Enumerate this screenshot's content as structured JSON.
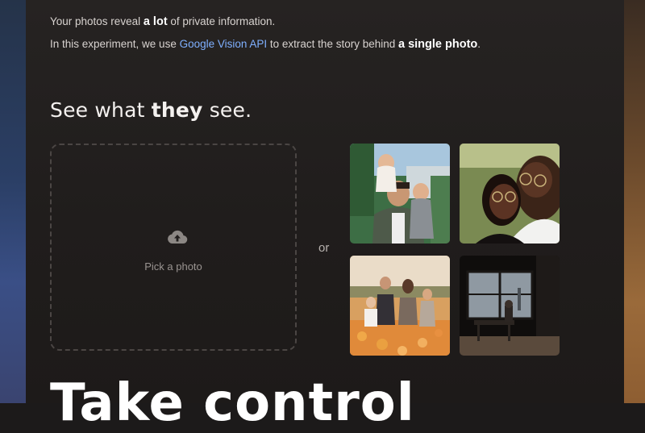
{
  "intro": {
    "line1_before": "Your photos reveal ",
    "line1_bold": "a lot",
    "line1_after": " of private information.",
    "line2_before": "In this experiment, we use ",
    "line2_link": "Google Vision API",
    "line2_middle": " to extract the story behind ",
    "line2_bold": "a single photo",
    "line2_after": "."
  },
  "headline": {
    "before": "See what ",
    "bold": "they",
    "after": " see."
  },
  "upload": {
    "icon": "cloud-upload-icon",
    "label": "Pick a photo"
  },
  "separator": "or",
  "sample_photos": [
    {
      "name": "photo-family-dad-kids"
    },
    {
      "name": "photo-couple-glasses"
    },
    {
      "name": "photo-family-flower-field"
    },
    {
      "name": "photo-interior-window-city"
    }
  ],
  "section_title": "Take control",
  "colors": {
    "link": "#7fb0ff",
    "background": "#1c1a1a",
    "dashed_border": "#4b4644"
  }
}
